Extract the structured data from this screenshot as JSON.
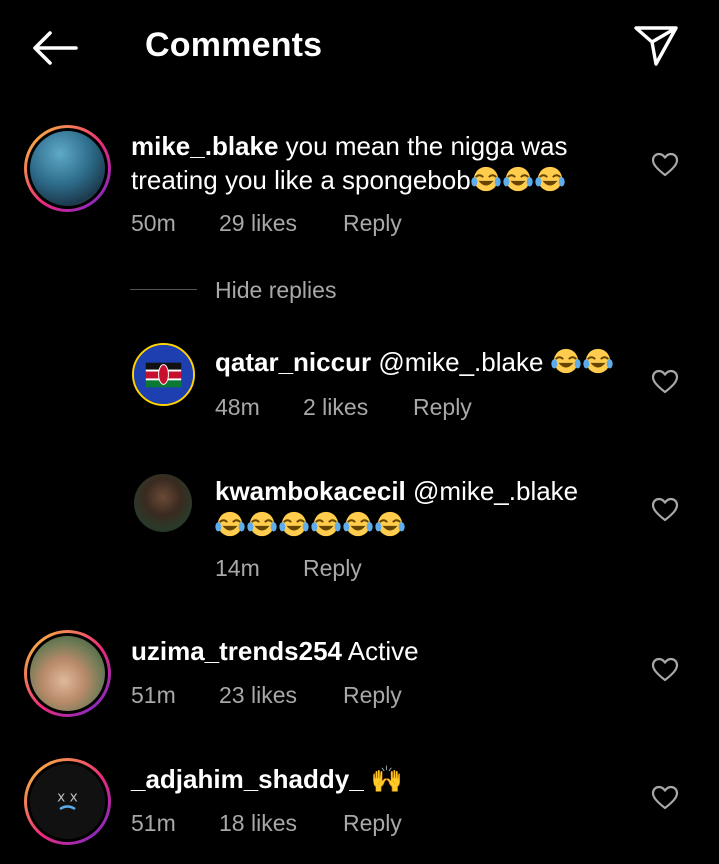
{
  "header": {
    "title": "Comments",
    "back_icon": "arrow-left-icon",
    "share_icon": "paper-plane-icon"
  },
  "comments": [
    {
      "username": "mike_.blake",
      "text_line1": "you mean the nigga was",
      "text_line2": "treating you like a spongebob",
      "emoji": "😂😂😂",
      "time": "50m",
      "likes": "29 likes",
      "reply": "Reply"
    },
    {
      "username": "uzima_trends254",
      "text": "Active",
      "time": "51m",
      "likes": "23 likes",
      "reply": "Reply"
    },
    {
      "username": "_adjahim_shaddy_",
      "emoji": "🙌",
      "time": "51m",
      "likes": "18 likes",
      "reply": "Reply"
    }
  ],
  "hide_replies": "Hide replies",
  "replies": [
    {
      "username": "qatar_niccur",
      "mention": "@mike_.blake",
      "emoji": "😂😂",
      "time": "48m",
      "likes": "2 likes",
      "reply": "Reply"
    },
    {
      "username": "kwambokacecil",
      "mention": "@mike_.blake",
      "emoji": "😂😂😂😂😂😂",
      "time": "14m",
      "reply": "Reply"
    }
  ],
  "colors": {
    "background": "#000000",
    "secondary_text": "#a8a8a8",
    "story_ring": "#ee2a7b"
  }
}
